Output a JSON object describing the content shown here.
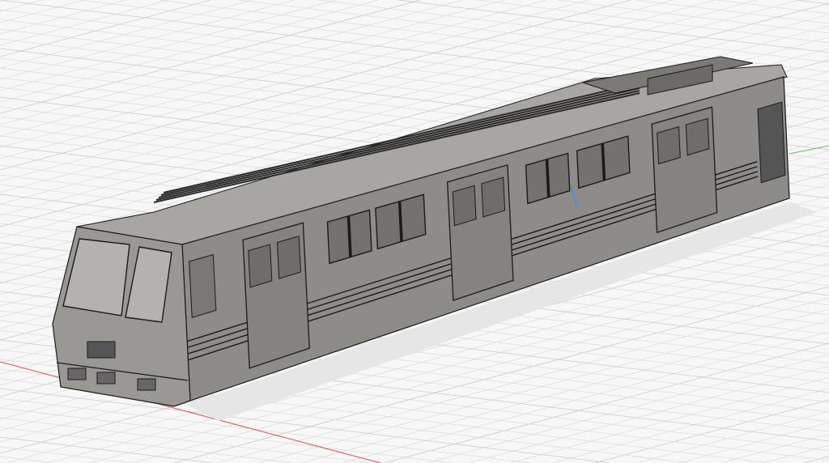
{
  "viewport": {
    "background_color": "#f7f7f7",
    "grid_minor_color": "#dcdcdc",
    "grid_major_color": "#c8c8c8",
    "x_axis_color": "#e05050",
    "y_axis_color": "#5cc05c",
    "model_body_color": "#8e8c88",
    "model_roof_color": "#a8a6a2",
    "model_front_color": "#9a9894",
    "model_edge_color": "#1a1a1a",
    "selection_highlight_color": "#4a90e2"
  }
}
